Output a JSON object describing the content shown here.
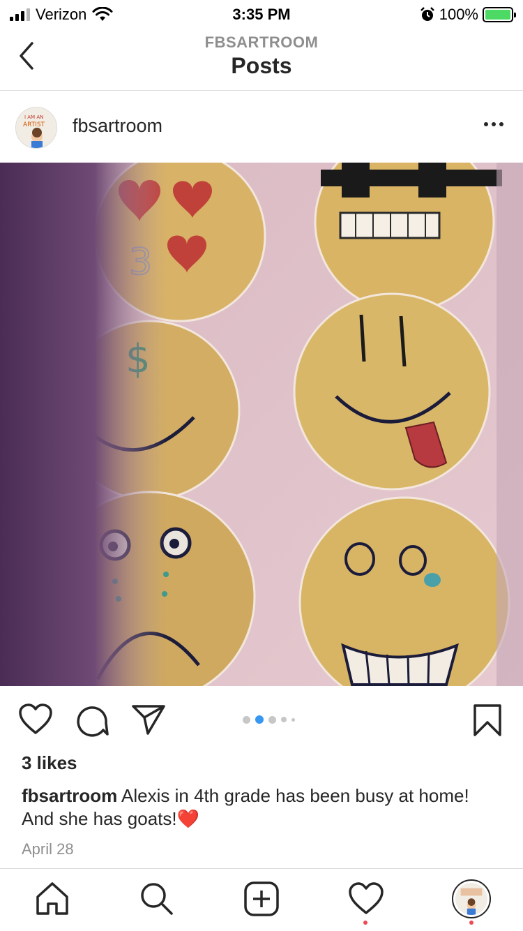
{
  "status_bar": {
    "carrier": "Verizon",
    "time": "3:35 PM",
    "battery": "100%"
  },
  "header": {
    "subtitle": "FBSARTROOM",
    "title": "Posts"
  },
  "post": {
    "username": "fbsartroom",
    "likes": "3 likes",
    "caption_user": "fbsartroom",
    "caption_text": "Alexis in 4th grade has been busy at home!  And she has goats!❤️",
    "date": "April 28",
    "carousel": {
      "count": 5,
      "active_index": 1
    },
    "image_desc": "drawing-emoji-faces"
  },
  "avatar_text": {
    "line1": "I AM AN",
    "line2": "ARTIST"
  },
  "colors": {
    "accent_blue": "#3897f0",
    "notification_red": "#ed4956",
    "battery_green": "#4cd964",
    "muted": "#8e8e8e"
  },
  "tabs": [
    "home-icon",
    "search-icon",
    "new-post-icon",
    "activity-heart-icon",
    "profile-avatar"
  ]
}
